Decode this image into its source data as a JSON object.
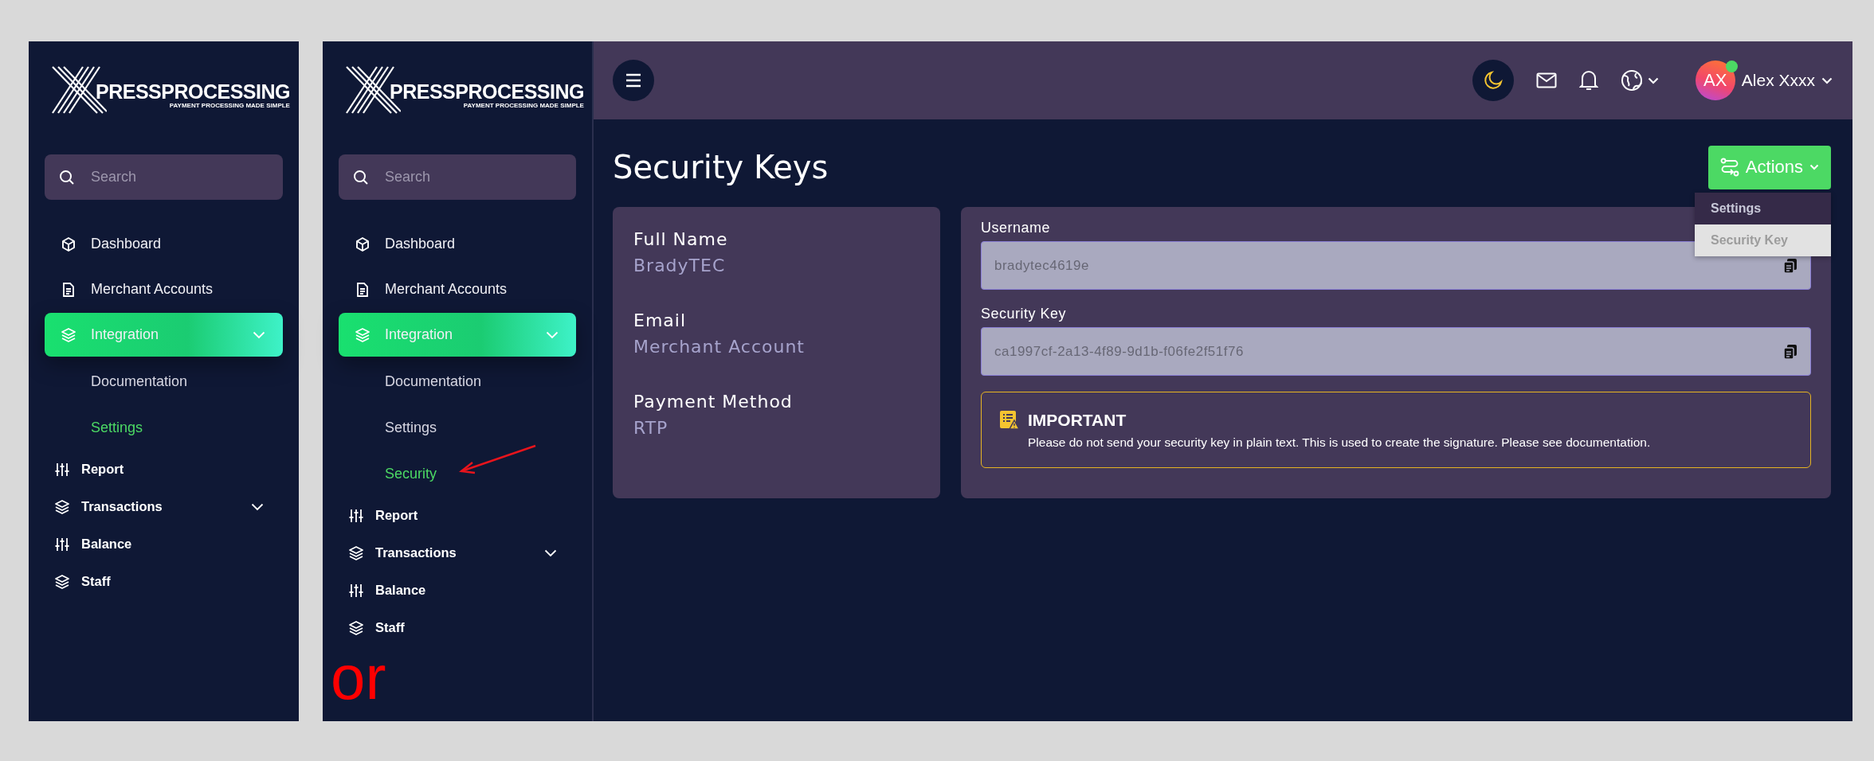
{
  "sidebars": [
    {
      "logo": {
        "wordmark": "PRESSPROCESSING",
        "tagline": "PAYMENT PROCESSING MADE SIMPLE"
      },
      "search": {
        "placeholder": "Search"
      },
      "nav": [
        {
          "label": "Dashboard",
          "kind": "primary",
          "selected": false
        },
        {
          "label": "Merchant Accounts",
          "kind": "primary",
          "selected": false
        },
        {
          "label": "Integration",
          "kind": "primary",
          "selected": true,
          "submenu": true,
          "children": [
            {
              "label": "Documentation",
              "selected": false
            },
            {
              "label": "Settings",
              "selected": true
            }
          ]
        },
        {
          "label": "Report",
          "kind": "secondary",
          "selected": false
        },
        {
          "label": "Transactions",
          "kind": "secondary",
          "selected": false,
          "submenu": true
        },
        {
          "label": "Balance",
          "kind": "secondary",
          "selected": false
        },
        {
          "label": "Staff",
          "kind": "secondary",
          "selected": false
        }
      ]
    },
    {
      "logo": {
        "wordmark": "PRESSPROCESSING",
        "tagline": "PAYMENT PROCESSING MADE SIMPLE"
      },
      "search": {
        "placeholder": "Search"
      },
      "nav": [
        {
          "label": "Dashboard",
          "kind": "primary",
          "selected": false
        },
        {
          "label": "Merchant Accounts",
          "kind": "primary",
          "selected": false
        },
        {
          "label": "Integration",
          "kind": "primary",
          "selected": true,
          "submenu": true,
          "children": [
            {
              "label": "Documentation",
              "selected": false
            },
            {
              "label": "Settings",
              "selected": false
            },
            {
              "label": "Security",
              "selected": true
            }
          ]
        },
        {
          "label": "Report",
          "kind": "secondary",
          "selected": false
        },
        {
          "label": "Transactions",
          "kind": "secondary",
          "selected": false,
          "submenu": true
        },
        {
          "label": "Balance",
          "kind": "secondary",
          "selected": false
        },
        {
          "label": "Staff",
          "kind": "secondary",
          "selected": false
        }
      ]
    }
  ],
  "annotation": {
    "text": "or"
  },
  "header": {
    "user": {
      "initials": "AX",
      "name": "Alex Xxxx",
      "online": true
    }
  },
  "page": {
    "title": "Security Keys",
    "actions": {
      "label": "Actions",
      "menu": [
        {
          "label": "Settings",
          "selected": false
        },
        {
          "label": "Security Key",
          "selected": true
        }
      ]
    },
    "info": [
      {
        "label": "Full Name",
        "value": "BradyTEC"
      },
      {
        "label": "Email",
        "value": "Merchant Account"
      },
      {
        "label": "Payment Method",
        "value": "RTP"
      }
    ],
    "keys": [
      {
        "label": "Username",
        "value": "bradytec4619e"
      },
      {
        "label": "Security Key",
        "value": "ca1997cf-2a13-4f89-9d1b-f06fe2f51f76"
      }
    ],
    "notice": {
      "title": "IMPORTANT",
      "text": "Please do not send your security key in plain text. This is used to create the signature. Please see documentation."
    }
  }
}
